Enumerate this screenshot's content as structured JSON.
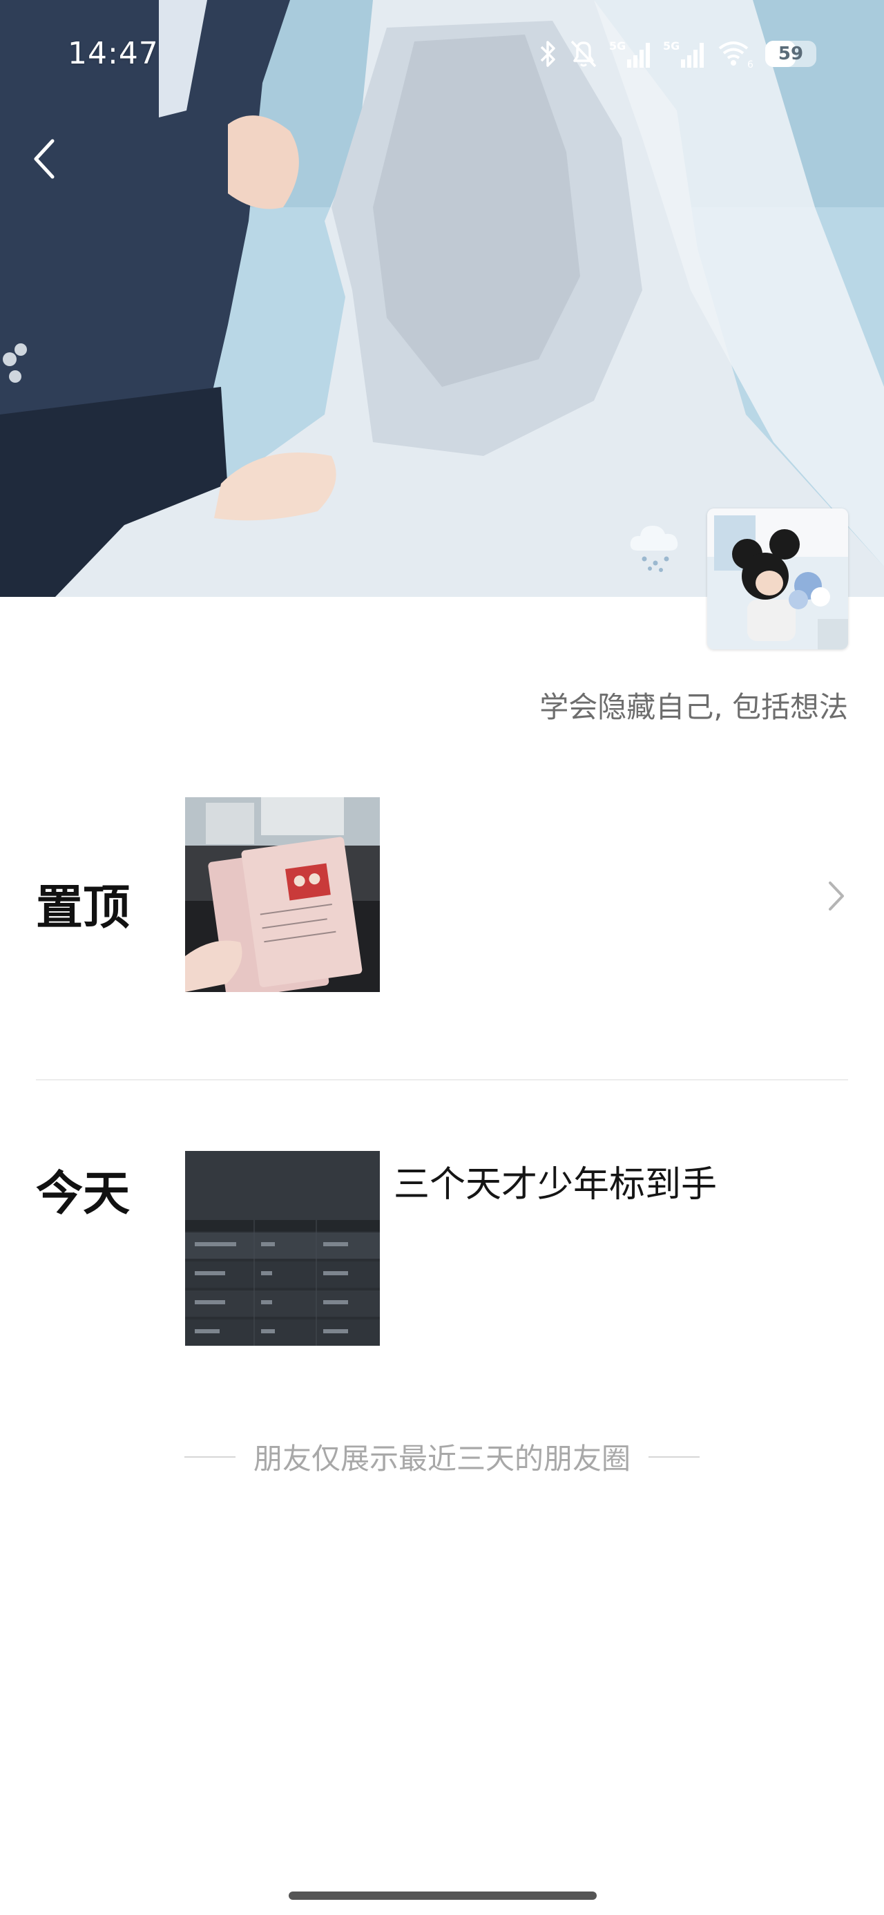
{
  "status_bar": {
    "time": "14:47",
    "network_label_1": "5G",
    "network_label_2": "5G",
    "wifi_badge": "6",
    "battery_text": "59",
    "battery_level": 0.59
  },
  "profile": {
    "signature": "学会隐藏自己, 包括想法"
  },
  "sections": {
    "pinned_label": "置顶",
    "today_label": "今天",
    "today_post_text": "三个天才少年标到手"
  },
  "footer": {
    "note": "朋友仅展示最近三天的朋友圈"
  },
  "icons": {
    "back": "chevron-left-icon",
    "weather": "snow-cloud-icon",
    "more": "chevron-right-icon",
    "bluetooth": "bluetooth-icon",
    "mute": "bell-off-icon",
    "wifi": "wifi-icon"
  },
  "colors": {
    "footer_text": "#a8a8a8",
    "signature_text": "#6d6d6d"
  }
}
